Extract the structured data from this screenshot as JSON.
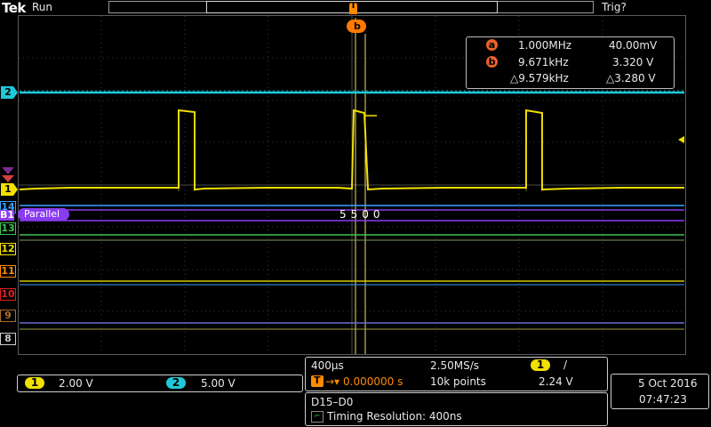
{
  "brand": "Tek",
  "status": "Run",
  "trigger_status": "Trig?",
  "trigger_marker": "T",
  "cursor_b_label": "b",
  "measurements": {
    "a": {
      "badge": "a",
      "freq": "1.000MHz",
      "volt": "40.00mV"
    },
    "b": {
      "badge": "b",
      "freq": "9.671kHz",
      "volt": "3.320 V"
    },
    "delta": {
      "freq": "△9.579kHz",
      "volt": "△3.280 V"
    }
  },
  "channels": {
    "ch2": {
      "label": "2",
      "color": "#1fc8d8"
    },
    "ch1": {
      "label": "1",
      "color": "#f2e000"
    },
    "digital": [
      {
        "label": "14",
        "color": "#3aa0ff"
      },
      {
        "label": "13",
        "color": "#3ec24b"
      },
      {
        "label": "12",
        "color": "#f2e000"
      },
      {
        "label": "11",
        "color": "#ff8a00"
      },
      {
        "label": "10",
        "color": "#e02020"
      },
      {
        "label": "9",
        "color": "#b07030"
      },
      {
        "label": "8",
        "color": "#cccccc"
      }
    ]
  },
  "bus": {
    "label": "B1",
    "name": "Parallel",
    "value": "5500",
    "color": "#8a3cf0"
  },
  "scale": {
    "ch1": {
      "badge": "1",
      "value": "2.00 V"
    },
    "ch2": {
      "badge": "2",
      "value": "5.00 V"
    }
  },
  "horizontal": {
    "timebase": "400µs",
    "sample_rate": "2.50MS/s",
    "trigger_pos": "0.000000 s",
    "record": "10k points",
    "trig_source": "1",
    "trig_slope": "/",
    "trig_level": "2.24 V"
  },
  "date": "5 Oct  2016",
  "time": "07:47:23",
  "digital_info": {
    "group": "D15–D0",
    "resolution": "Timing Resolution: 400ns"
  }
}
